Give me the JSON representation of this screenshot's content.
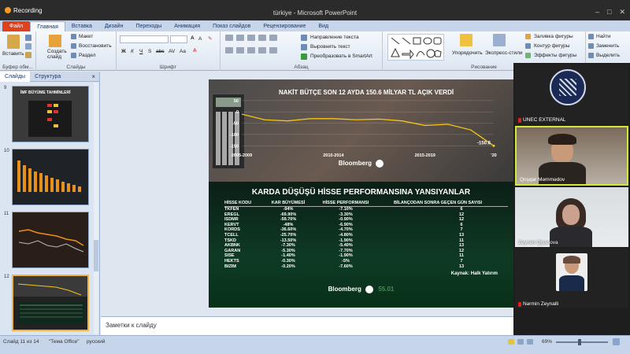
{
  "titlebar": {
    "recording": "Recording",
    "title": "türkiye  -  Microsoft PowerPoint"
  },
  "ribbon_tabs": [
    "Файл",
    "Главная",
    "Вставка",
    "Дизайн",
    "Переходы",
    "Анимация",
    "Показ слайдов",
    "Рецензирование",
    "Вид"
  ],
  "ribbon": {
    "paste": "Вставить",
    "clipboard": "Буфер обм...",
    "new_slide": "Создать слайд",
    "layout": "Макет",
    "reset": "Восстановить",
    "section": "Раздел",
    "slides_group": "Слайды",
    "font_group": "Шрифт",
    "text_direction": "Направление текста",
    "align_text": "Выровнять текст",
    "smartart": "Преобразовать в SmartArt",
    "paragraph_group": "Абзац",
    "arrange": "Упорядочить",
    "quick_styles": "Экспресс-стили",
    "shape_fill": "Заливка фигуры",
    "shape_outline": "Контур фигуры",
    "shape_effects": "Эффекты фигуры",
    "drawing_group": "Рисование",
    "find": "Найти",
    "replace": "Заменить",
    "select": "Выделить"
  },
  "sidebar": {
    "tabs": [
      "Слайды",
      "Структура"
    ],
    "close": "×",
    "thumbs": [
      {
        "num": "9",
        "title": "İMF BÜYÜME TAHMİNLERİ",
        "selected": false
      },
      {
        "num": "10",
        "title": "",
        "selected": false
      },
      {
        "num": "11",
        "title": "",
        "selected": false
      },
      {
        "num": "12",
        "title": "",
        "selected": true
      }
    ]
  },
  "slide": {
    "chart_title": "NAKİT BÜTÇE SON 12 AYDA 150.6 MİLYAR TL AÇIK VERDİ",
    "y_ticks": [
      "50",
      "0",
      "-50",
      "-100",
      "-150"
    ],
    "x_ticks": [
      "2005-2009",
      "2010-2014",
      "2015-2019",
      "'20"
    ],
    "end_label": "-150.6",
    "brand": "Bloomberg",
    "table_title": "KARDA DÜŞÜŞÜ HİSSE PERFORMANSINA YANSIYANLAR",
    "columns": [
      "HİSSE KODU",
      "KAR BÜYÜMESİ",
      "HİSSE PERFORMANSI",
      "BİLANÇODAN SONRA GEÇEN GÜN SAYISI"
    ],
    "rows": [
      [
        "TKFEN",
        "-94%",
        "-7.10%",
        "6"
      ],
      [
        "EREGL",
        "-69.90%",
        "-3.30%",
        "12"
      ],
      [
        "ISDMR",
        "-59.70%",
        "-0.90%",
        "12"
      ],
      [
        "KERVT",
        "-48%",
        "-6.90%",
        "6"
      ],
      [
        "KORDS",
        "-36.60%",
        "-4.70%",
        "7"
      ],
      [
        "TCELL",
        "-25.70%",
        "-4.80%",
        "13"
      ],
      [
        "TSKD",
        "-13.50%",
        "-1.90%",
        "11"
      ],
      [
        "AKBNK",
        "-7.30%",
        "-5.40%",
        "13"
      ],
      [
        "GARAN",
        "-5.30%",
        "-7.70%",
        "12"
      ],
      [
        "SISE",
        "-1.40%",
        "-1.90%",
        "11"
      ],
      [
        "HEKTS",
        "-0.30%",
        "-5%",
        "7"
      ],
      [
        "BIZIM",
        "-0.20%",
        "-7.60%",
        "13"
      ]
    ],
    "source": "Kaynak: Halk Yatırım",
    "ticker": "55.01"
  },
  "chart_data": {
    "type": "line",
    "x": [
      "2005-2009",
      "",
      "",
      "",
      "2010-2014",
      "",
      "",
      "",
      "2015-2019",
      "",
      "",
      "'20"
    ],
    "values": [
      -10,
      -35,
      -40,
      -30,
      -30,
      -35,
      -32,
      -40,
      -60,
      -55,
      -80,
      -150.6
    ],
    "yticks": [
      50,
      0,
      -50,
      -100,
      -150
    ],
    "ylim": [
      -170,
      60
    ],
    "color": "#f5c518"
  },
  "notes_placeholder": "Заметки к слайду",
  "status": {
    "slide": "Слайд 11 из 14",
    "theme": "\"Тема Office\"",
    "lang": "русский",
    "zoom": "69%"
  },
  "participants": [
    {
      "name": "UNEC EXTERNAL",
      "muted": true,
      "kind": "logo"
    },
    {
      "name": "Qoşqar Məmmədov",
      "muted": false,
      "kind": "man"
    },
    {
      "name": "Zeyneb Qiyasova",
      "muted": false,
      "kind": "woman"
    },
    {
      "name": "Nərmin Zeynalli",
      "muted": true,
      "kind": "photo"
    }
  ]
}
